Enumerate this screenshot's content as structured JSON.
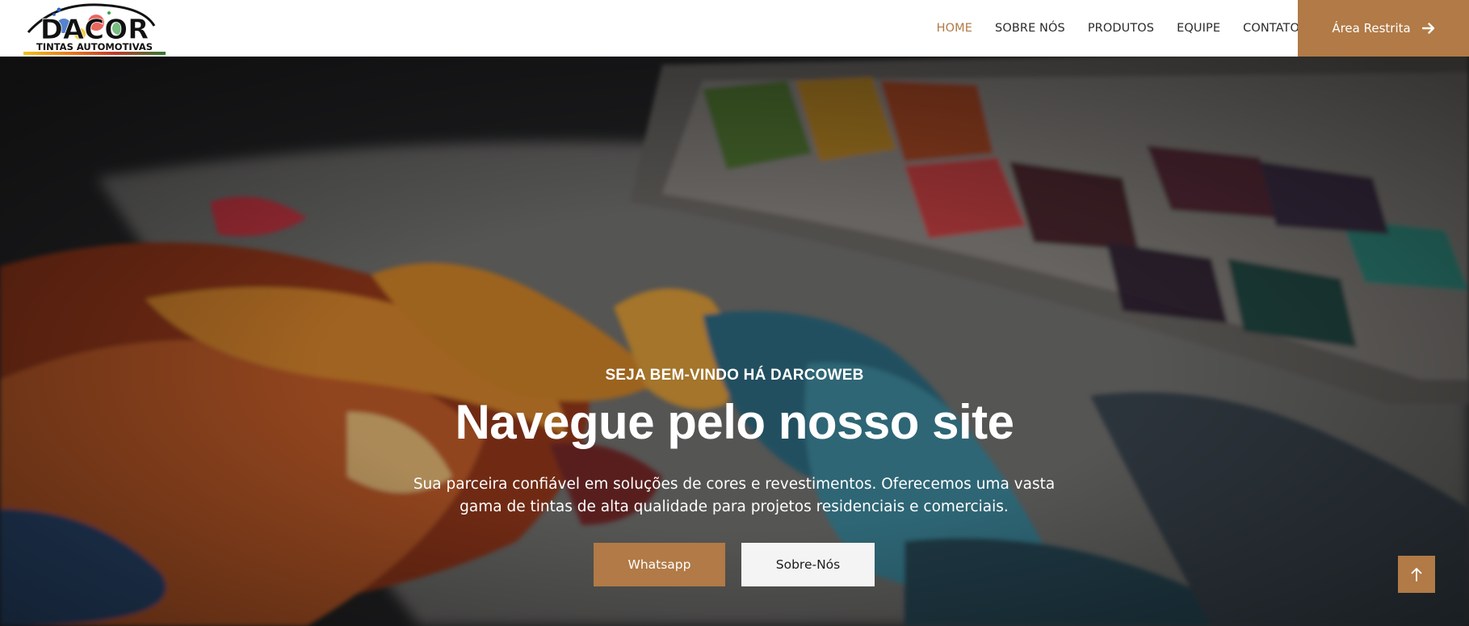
{
  "header": {
    "logo": {
      "brand": "DACOR",
      "tagline": "TINTAS AUTOMOTIVAS"
    },
    "nav": [
      {
        "label": "HOME",
        "active": true
      },
      {
        "label": "SOBRE NÓS",
        "active": false
      },
      {
        "label": "PRODUTOS",
        "active": false
      },
      {
        "label": "EQUIPE",
        "active": false
      },
      {
        "label": "CONTATO",
        "active": false
      }
    ],
    "restricted_button": {
      "label": "Área Restrita",
      "icon": "arrow-right-icon"
    }
  },
  "hero": {
    "subtitle": "SEJA BEM-VINDO HÁ DARCOWEB",
    "title": "Navegue pelo nosso site",
    "description": "Sua parceira confiável em soluções de cores e revestimentos. Oferecemos uma vasta gama de tintas de alta qualidade para projetos residenciais e comerciais.",
    "buttons": {
      "whatsapp": "Whatsapp",
      "about": "Sobre-Nós"
    }
  },
  "back_to_top": {
    "icon": "arrow-up-icon"
  },
  "colors": {
    "accent": "#b17a46",
    "header_bg": "#ffffff",
    "nav_text": "#2b2b2b",
    "hero_text": "#ffffff",
    "secondary_button": "#f4f4f4"
  }
}
